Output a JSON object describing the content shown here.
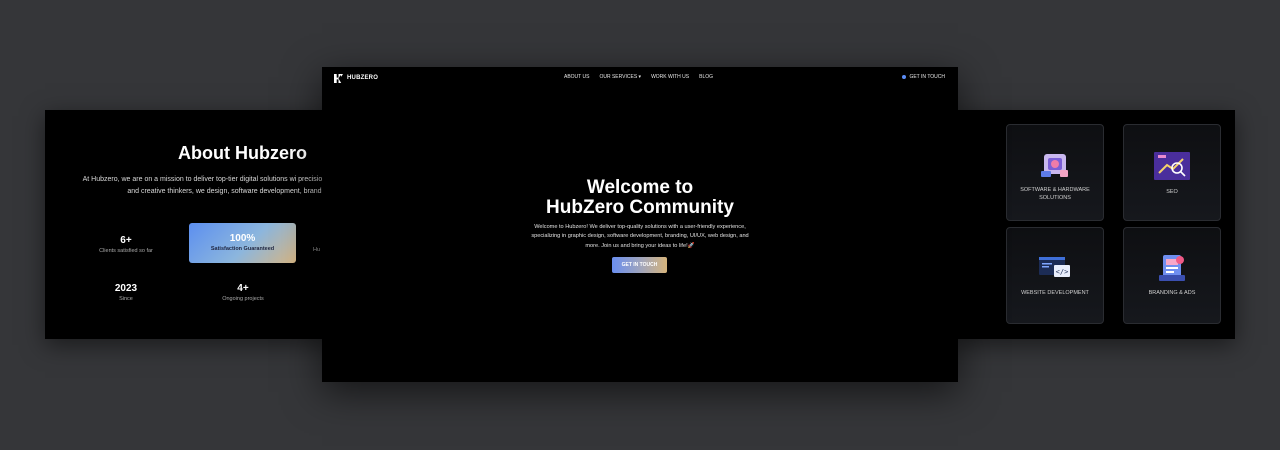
{
  "about": {
    "title": "About Hubzero",
    "description": "At Hubzero, we are on a mission to deliver top-tier digital solutions wi precision. Founded by designers, developers, and creative thinkers, we design, software development, branding, UI/UX, web design,",
    "stats": [
      {
        "value": "6+",
        "label": "Clients satisfied so far"
      },
      {
        "value": "100%",
        "label": "Satisfaction Guaranteed"
      },
      {
        "value": "2023",
        "label": "Since"
      },
      {
        "value": "4+",
        "label": "Ongoing projects"
      }
    ],
    "partial_label": "Hu"
  },
  "hero": {
    "brand": "HUBZERO",
    "nav": [
      "ABOUT US",
      "OUR SERVICES ▾",
      "WORK WITH US",
      "BLOG"
    ],
    "nav_cta": "GET IN TOUCH",
    "title_line1": "Welcome to",
    "title_line2": "HubZero Community",
    "description": "Welcome to Hubzero! We deliver top-quality solutions with a user-friendly experience, specializing in graphic design, software development, branding, UI/UX, web design, and more. Join us and bring your ideas to life!🚀",
    "button": "GET IN TOUCH"
  },
  "services": [
    {
      "label": "SOFTWARE & HARDWARE SOLUTIONS",
      "icon": "software-hardware-icon"
    },
    {
      "label": "SEO",
      "icon": "seo-icon"
    },
    {
      "label": "WEBSITE DEVELOPMENT",
      "icon": "website-development-icon"
    },
    {
      "label": "BRANDING & ADS",
      "icon": "branding-ads-icon"
    }
  ],
  "colors": {
    "page_bg": "#353639",
    "panel_bg": "#000000",
    "accent_blue": "#5b8cf5",
    "accent_gold": "#d6b47c"
  }
}
